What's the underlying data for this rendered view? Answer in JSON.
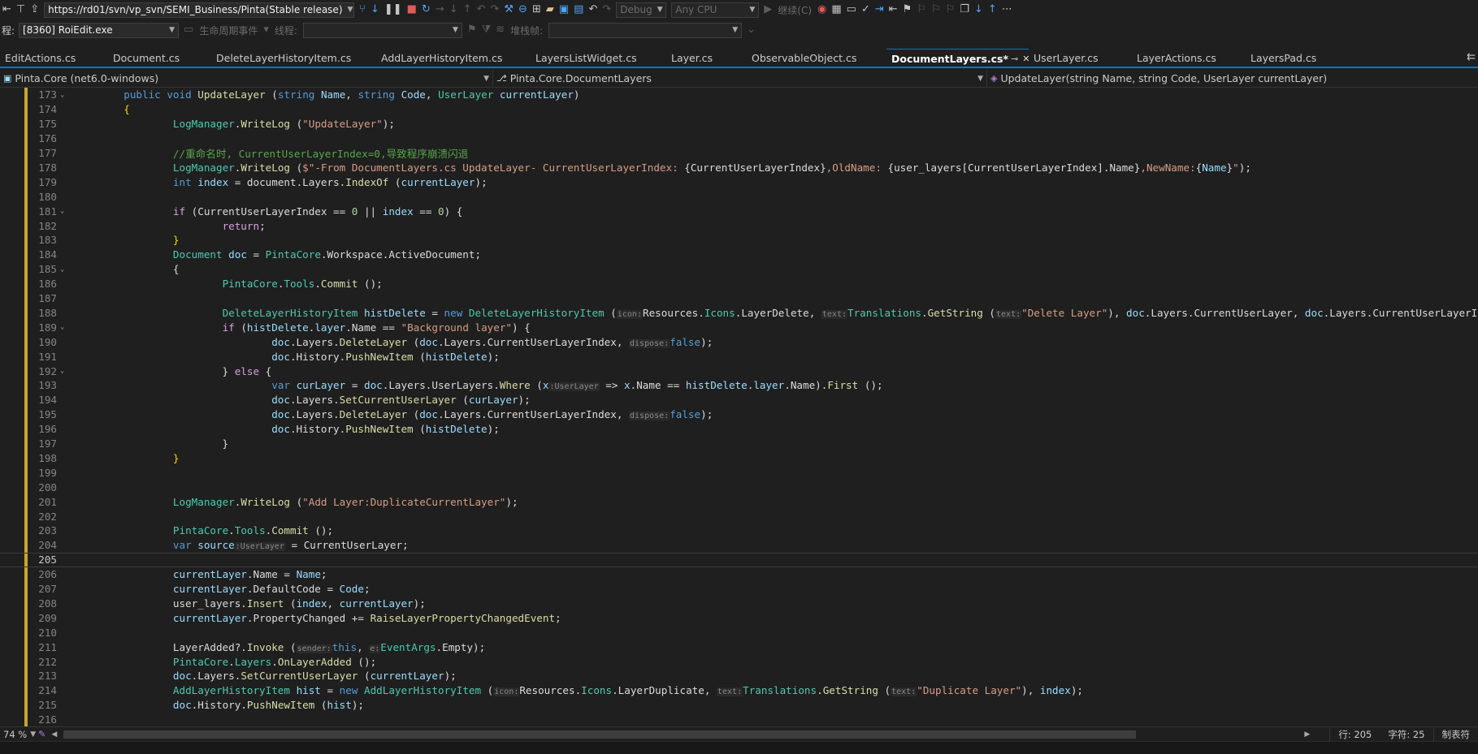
{
  "toolbar_top": {
    "url": "https://rd01/svn/vp_svn/SEMI_Business/Pinta(Stable release)",
    "debug_config": "Debug",
    "platform": "Any CPU",
    "continue_label": "继续(C)"
  },
  "toolbar_second": {
    "process_label": "程:",
    "process_value": "[8360] RoiEdit.exe",
    "lifecycle_label": "生命周期事件",
    "thread_label": "线程:",
    "stackframe_label": "堆栈帧:"
  },
  "tabs": [
    {
      "label": "EditActions.cs",
      "active": false
    },
    {
      "label": "Document.cs",
      "active": false
    },
    {
      "label": "DeleteLayerHistoryItem.cs",
      "active": false
    },
    {
      "label": "AddLayerHistoryItem.cs",
      "active": false
    },
    {
      "label": "LayersListWidget.cs",
      "active": false
    },
    {
      "label": "Layer.cs",
      "active": false
    },
    {
      "label": "ObservableObject.cs",
      "active": false
    },
    {
      "label": "DocumentLayers.cs*",
      "active": true
    },
    {
      "label": "UserLayer.cs",
      "active": false
    },
    {
      "label": "LayerActions.cs",
      "active": false
    },
    {
      "label": "LayersPad.cs",
      "active": false
    }
  ],
  "nav": {
    "project": "Pinta.Core (net6.0-windows)",
    "type": "Pinta.Core.DocumentLayers",
    "member": "UpdateLayer(string Name, string Code, UserLayer currentLayer)"
  },
  "editor": {
    "current_line": "205",
    "line_numbers": [
      "173",
      "174",
      "175",
      "176",
      "177",
      "178",
      "179",
      "180",
      "181",
      "182",
      "183",
      "184",
      "185",
      "186",
      "187",
      "188",
      "189",
      "190",
      "191",
      "192",
      "193",
      "194",
      "195",
      "196",
      "197",
      "198",
      "199",
      "200",
      "201",
      "202",
      "203",
      "204",
      "205",
      "206",
      "207",
      "208",
      "209",
      "210",
      "211",
      "212",
      "213",
      "214",
      "215",
      "216"
    ],
    "hints": {
      "icon": "icon:",
      "text": "text:",
      "dispose": "dispose:",
      "x_type": ":UserLayer",
      "sender": "sender:",
      "e": "e:"
    }
  },
  "status": {
    "zoom": "74 %",
    "row": "行: 205",
    "col": "字符: 25",
    "tab_mode": "制表符"
  },
  "colors": {
    "background": "#1f1f1f",
    "keyword": "#569cd6",
    "type": "#4ec9b0",
    "method": "#dcdcaa",
    "string": "#d69d85",
    "comment": "#57a64a",
    "accent": "#007acc",
    "change_margin": "#c8a52c"
  }
}
